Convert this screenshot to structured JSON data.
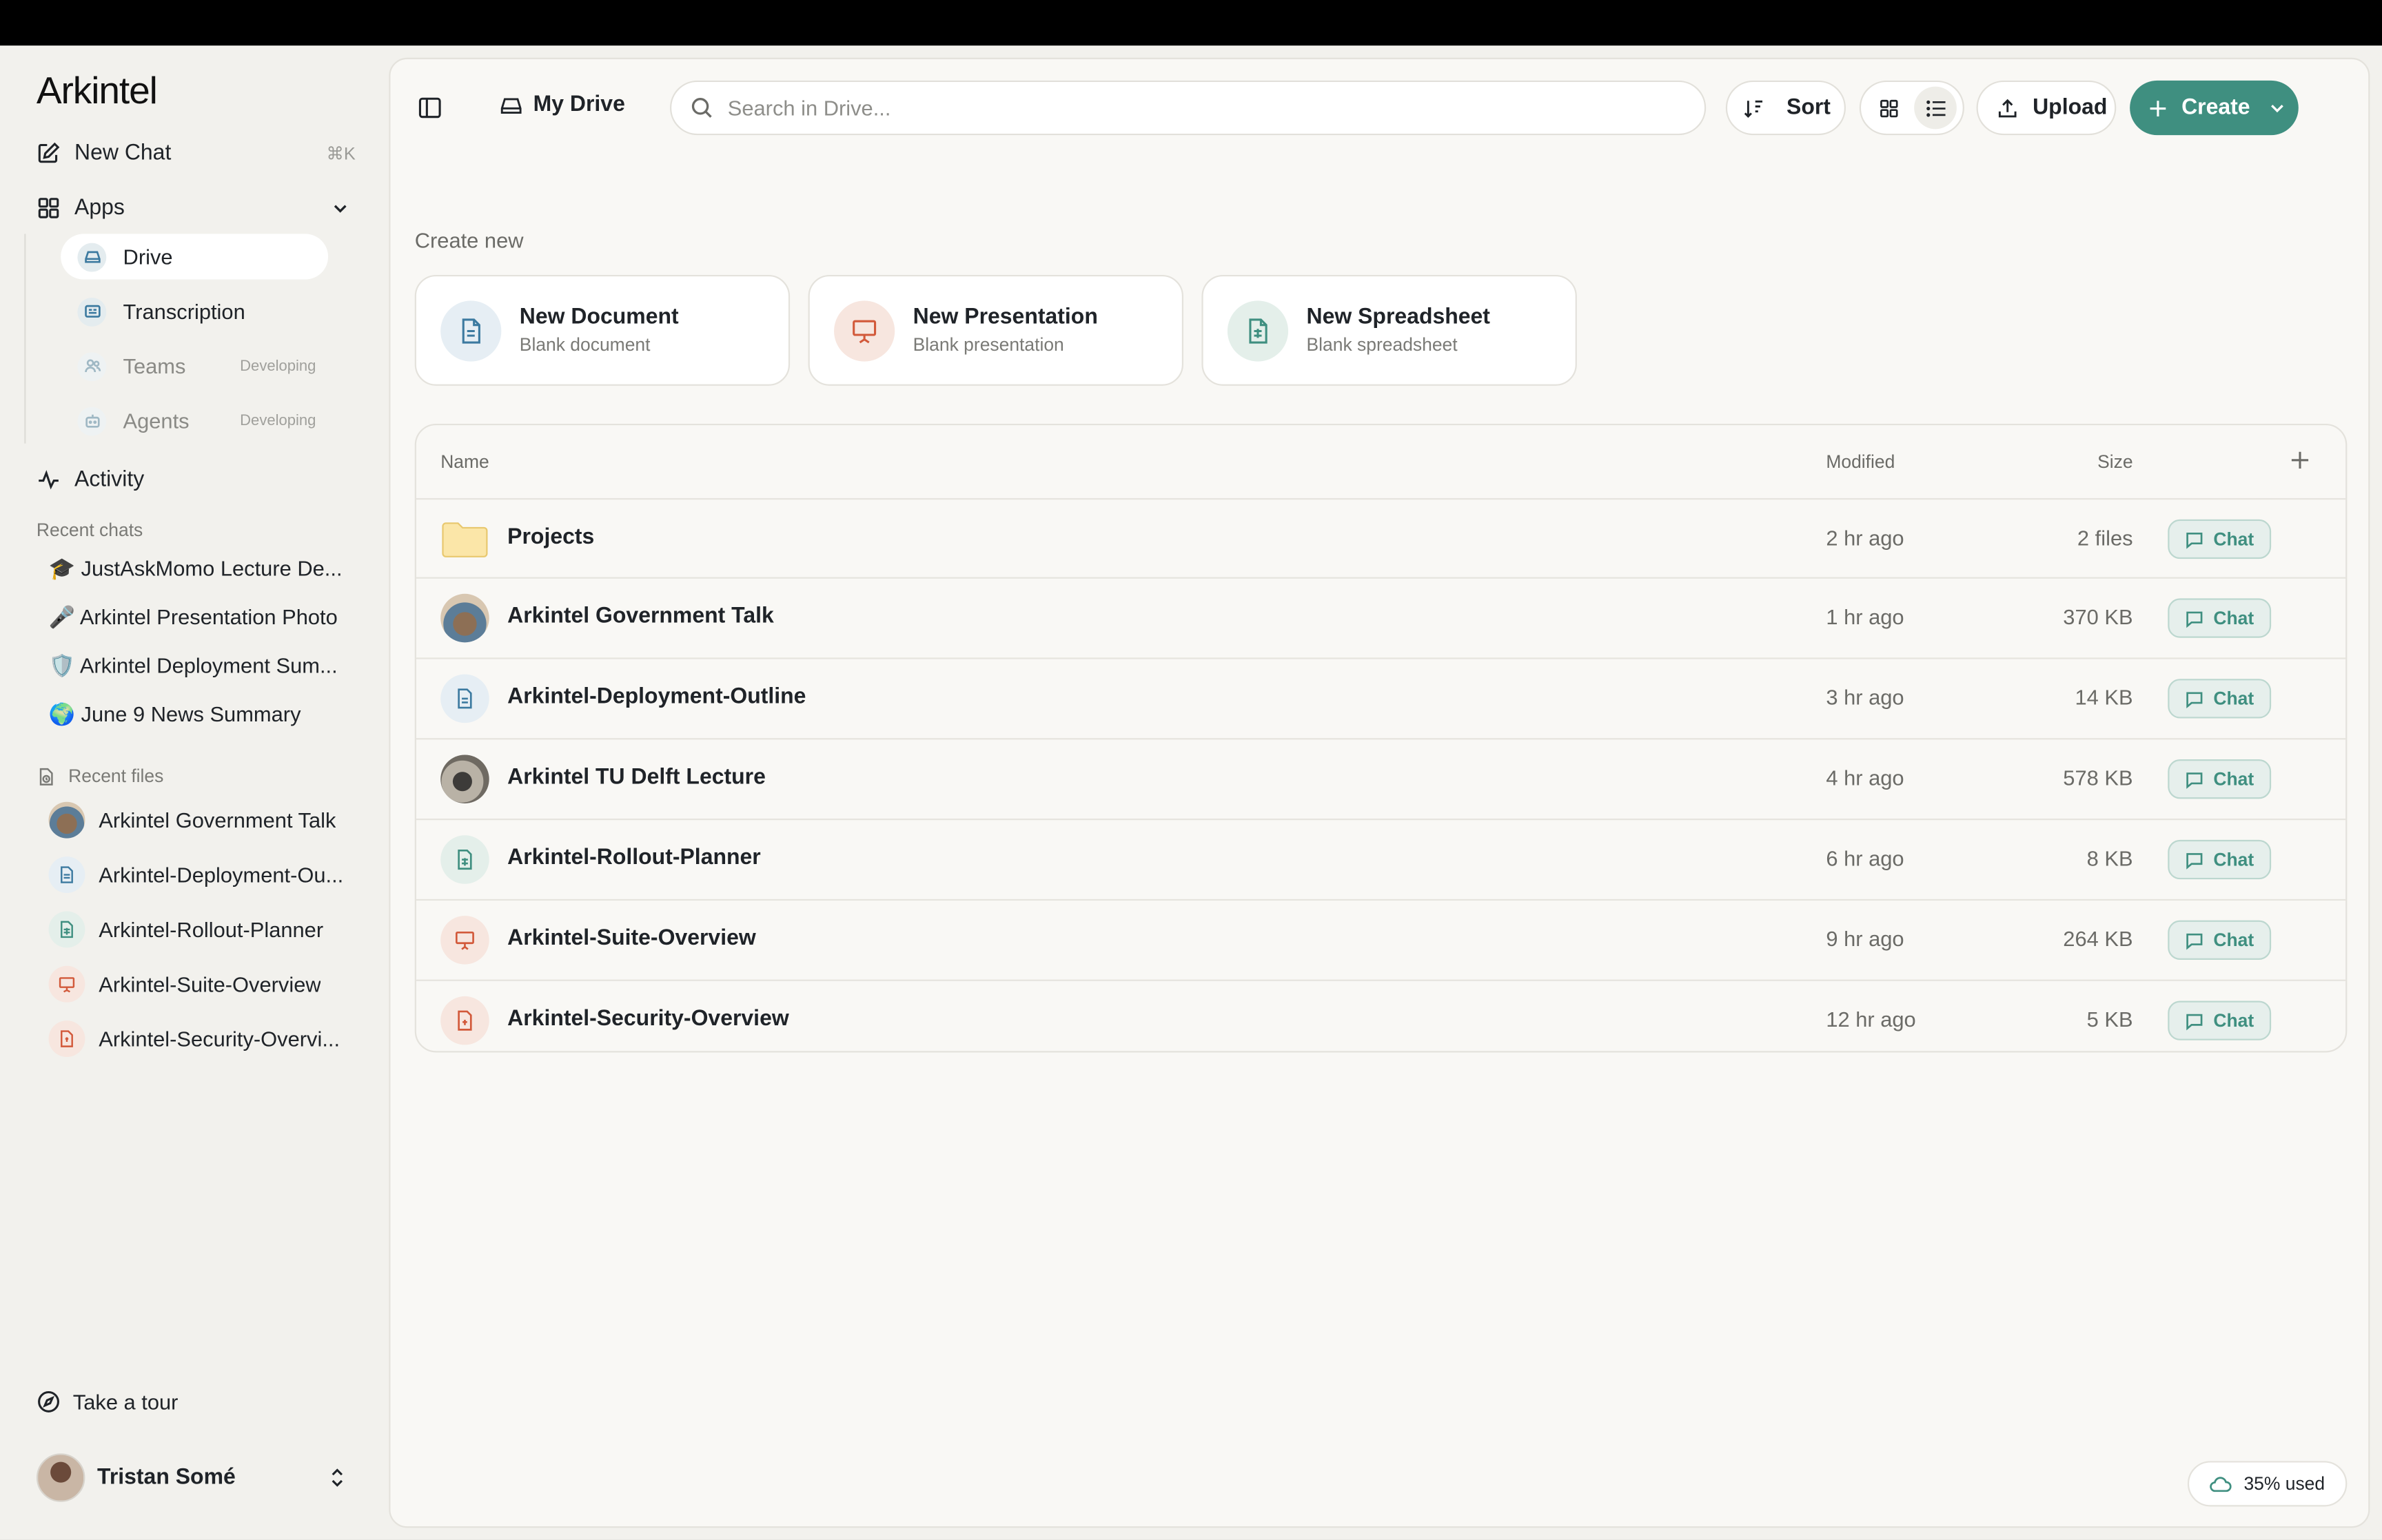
{
  "brand": {
    "logo_text": "Arkintel",
    "accent": "#3f8f80"
  },
  "sidebar": {
    "new_chat": {
      "label": "New Chat",
      "shortcut": "⌘K",
      "icon": "edit-icon"
    },
    "apps": {
      "label": "Apps",
      "items": [
        {
          "label": "Drive",
          "status": "",
          "icon": "drive-icon",
          "active": true
        },
        {
          "label": "Transcription",
          "status": "",
          "icon": "transcription-icon",
          "active": false
        },
        {
          "label": "Teams",
          "status": "Developing",
          "icon": "users-icon",
          "active": false
        },
        {
          "label": "Agents",
          "status": "Developing",
          "icon": "bot-icon",
          "active": false
        }
      ]
    },
    "activity": {
      "label": "Activity",
      "icon": "activity-icon"
    },
    "recent_chats": {
      "label": "Recent chats",
      "items": [
        {
          "label": "🎓 JustAskMomo Lecture De..."
        },
        {
          "label": "🎤 Arkintel Presentation Photo"
        },
        {
          "label": "🛡️ Arkintel Deployment Sum..."
        },
        {
          "label": "🌍 June 9 News Summary"
        }
      ]
    },
    "recent_files": {
      "label": "Recent files",
      "items": [
        {
          "label": "Arkintel Government Talk",
          "type": "image"
        },
        {
          "label": "Arkintel-Deployment-Ou...",
          "type": "document"
        },
        {
          "label": "Arkintel-Rollout-Planner",
          "type": "spreadsheet"
        },
        {
          "label": "Arkintel-Suite-Overview",
          "type": "presentation"
        },
        {
          "label": "Arkintel-Security-Overvi...",
          "type": "pdf"
        }
      ]
    },
    "tour": {
      "label": "Take a tour"
    },
    "user": {
      "name": "Tristan Somé"
    }
  },
  "toolbar": {
    "location": "My Drive",
    "search_placeholder": "Search in Drive...",
    "sort_label": "Sort",
    "upload_label": "Upload",
    "create_label": "Create"
  },
  "create_new": {
    "label": "Create new",
    "cards": [
      {
        "title": "New Document",
        "subtitle": "Blank document",
        "type": "document"
      },
      {
        "title": "New Presentation",
        "subtitle": "Blank presentation",
        "type": "presentation"
      },
      {
        "title": "New Spreadsheet",
        "subtitle": "Blank spreadsheet",
        "type": "spreadsheet"
      }
    ]
  },
  "table": {
    "columns": {
      "name": "Name",
      "modified": "Modified",
      "size": "Size"
    },
    "chat_label": "Chat",
    "rows": [
      {
        "name": "Projects",
        "modified": "2 hr ago",
        "size": "2 files",
        "type": "folder"
      },
      {
        "name": "Arkintel Government Talk",
        "modified": "1 hr ago",
        "size": "370 KB",
        "type": "image"
      },
      {
        "name": "Arkintel-Deployment-Outline",
        "modified": "3 hr ago",
        "size": "14 KB",
        "type": "document"
      },
      {
        "name": "Arkintel TU Delft Lecture",
        "modified": "4 hr ago",
        "size": "578 KB",
        "type": "image"
      },
      {
        "name": "Arkintel-Rollout-Planner",
        "modified": "6 hr ago",
        "size": "8 KB",
        "type": "spreadsheet"
      },
      {
        "name": "Arkintel-Suite-Overview",
        "modified": "9 hr ago",
        "size": "264 KB",
        "type": "presentation"
      },
      {
        "name": "Arkintel-Security-Overview",
        "modified": "12 hr ago",
        "size": "5 KB",
        "type": "pdf"
      }
    ]
  },
  "storage": {
    "label": "35% used",
    "percent": 35
  }
}
